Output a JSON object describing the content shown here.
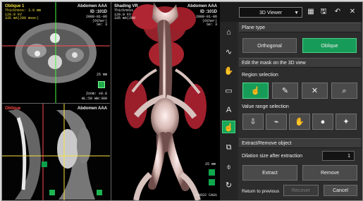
{
  "viewer": {
    "top_left": {
      "title": "Oblique 1",
      "meta": [
        "Thickness: 3.0 mm",
        "120.0 kV",
        "335 mA(200 msec)"
      ],
      "right_title": "Abdomen AAA",
      "right_id": "ID :101D",
      "right_meta": [
        "2008-01-06",
        "(Other)",
        "Se: 3"
      ],
      "scale": "25 mm",
      "zoom": "Zoom: x0.8",
      "wl": "WL:50 WW:300"
    },
    "bottom_left": {
      "title": "Oblique",
      "right_title": "Abdomen AAA"
    },
    "center": {
      "title": "Shading VR",
      "meta": [
        "Thickness",
        "120.0 kV",
        "335 mA(200"
      ],
      "right_title": "Abdomen AAA",
      "right_id": "ID :101D",
      "right_meta": [
        "2008-01-06",
        "(Other)",
        "Se: 3"
      ],
      "scale": "25 mm",
      "bottom_label": "LAO22 CAU1"
    }
  },
  "toolbar": {
    "view_label": "3D Viewer",
    "chevron": "▼",
    "icons": [
      "grid-icon",
      "save-icon",
      "undo-icon",
      "close-icon"
    ],
    "glyphs": [
      "▦",
      "🖫",
      "↶",
      "✕"
    ]
  },
  "tools": {
    "glyphs": [
      "⌂",
      "∿",
      "✋",
      "▭",
      "A",
      "☝",
      "⧉",
      "⌽",
      "↻"
    ],
    "names": [
      "viewer-tool",
      "curve-tool",
      "hand-tool",
      "shape-tool",
      "annotation-tool",
      "mask-tool",
      "copy-tool",
      "object-tool",
      "rotate-tool"
    ]
  },
  "panel": {
    "plane_type": {
      "header": "Plane type",
      "orthogonal": "Orthogonal",
      "oblique": "Oblique"
    },
    "edit_mask": {
      "header": "Edit the mask on the 3D view",
      "region_selection": "Region selection",
      "region_icons": [
        "☝",
        "✎",
        "✕",
        "⌕"
      ],
      "value_range": "Value range selection",
      "value_icons": [
        "⇩",
        "⌁",
        "✋",
        "●",
        "✦"
      ]
    },
    "extract": {
      "header": "Extract/Remove object",
      "dilation_label": "Dilation size after extraction",
      "dilation_value": "1",
      "extract_label": "Extract",
      "remove_label": "Remove",
      "return_label": "Return to previous",
      "recover_label": "Recover",
      "cancel_label": "Cancel"
    }
  }
}
